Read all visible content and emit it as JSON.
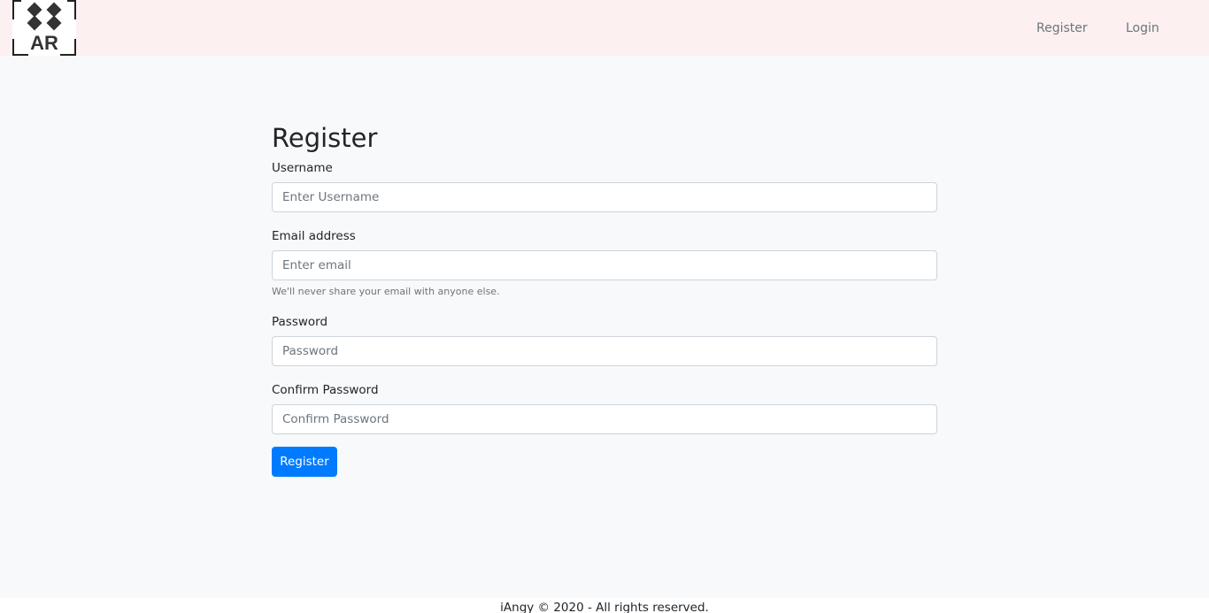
{
  "navbar": {
    "logo_text": "AR",
    "links": [
      {
        "label": "Register"
      },
      {
        "label": "Login"
      }
    ],
    "background_color": "#fcf0f1"
  },
  "form": {
    "title": "Register",
    "username": {
      "label": "Username",
      "placeholder": "Enter Username"
    },
    "email": {
      "label": "Email address",
      "placeholder": "Enter email",
      "help": "We'll never share your email with anyone else."
    },
    "password": {
      "label": "Password",
      "placeholder": "Password"
    },
    "confirm_password": {
      "label": "Confirm Password",
      "placeholder": "Confirm Password"
    },
    "submit_label": "Register",
    "submit_color": "#007bff"
  },
  "footer": {
    "text": "iAngy © 2020 - All rights reserved."
  }
}
